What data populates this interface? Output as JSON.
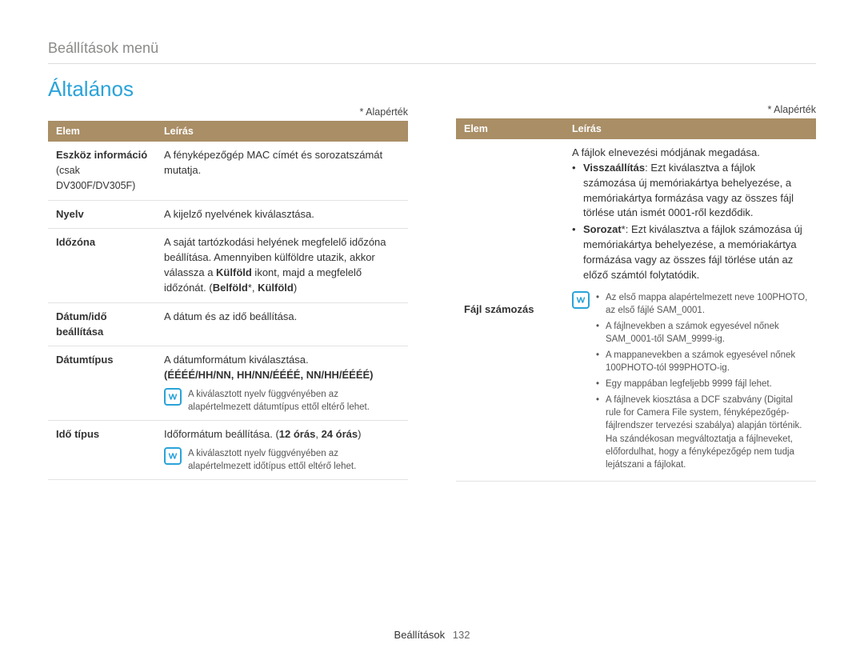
{
  "breadcrumb": "Beállítások menü",
  "section_title": "Általános",
  "default_note": "* Alapérték",
  "headers": {
    "item": "Elem",
    "desc": "Leírás"
  },
  "footer": {
    "section": "Beállítások",
    "page": "132"
  },
  "left": {
    "rows": {
      "r0": {
        "label_bold": "Eszköz információ",
        "label_sub": " (csak DV300F/DV305F)",
        "desc": "A fényképezőgép MAC címét és sorozatszámát mutatja."
      },
      "r1": {
        "label": "Nyelv",
        "desc": "A kijelző nyelvének kiválasztása."
      },
      "r2": {
        "label": "Időzóna",
        "desc_pre": "A saját tartózkodási helyének megfelelő időzóna beállítása. Amennyiben külföldre utazik, akkor válassza a ",
        "desc_bold1": "Külföld",
        "desc_mid": " ikont, majd a megfelelő időzónát. (",
        "desc_bold2": "Belföld",
        "desc_sep": "*, ",
        "desc_bold3": "Külföld",
        "desc_end": ")"
      },
      "r3": {
        "label": "Dátum/idő beállítása",
        "desc": "A dátum és az idő beállítása."
      },
      "r4": {
        "label": "Dátumtípus",
        "desc_line1": "A dátumformátum kiválasztása.",
        "desc_formats": "(ÉÉÉÉ/HH/NN, HH/NN/ÉÉÉÉ, NN/HH/ÉÉÉÉ)",
        "note": "A kiválasztott nyelv függvényében az alapértelmezett dátumtípus ettől eltérő lehet."
      },
      "r5": {
        "label": "Idő típus",
        "desc_pre": "Időformátum beállítása. (",
        "desc_b1": "12 órás",
        "desc_sep": ", ",
        "desc_b2": "24 órás",
        "desc_end": ")",
        "note": "A kiválasztott nyelv függvényében az alapértelmezett időtípus ettől eltérő lehet."
      }
    }
  },
  "right": {
    "row": {
      "label": "Fájl számozás",
      "intro": "A fájlok elnevezési módjának megadása.",
      "opt1_label": "Visszaállítás",
      "opt1_text": ": Ezt kiválasztva a fájlok számozása új memóriakártya behelyezése, a memóriakártya formázása vagy az összes fájl törlése után ismét 0001-ről kezdődik.",
      "opt2_label": "Sorozat",
      "opt2_text": "*: Ezt kiválasztva a fájlok számozása új memóriakártya behelyezése, a memóriakártya formázása vagy az összes fájl törlése után az előző számtól folytatódik.",
      "notes": {
        "n0": "Az első mappa alapértelmezett neve 100PHOTO, az első fájlé SAM_0001.",
        "n1": "A fájlnevekben a számok egyesével nőnek SAM_0001-től SAM_9999-ig.",
        "n2": "A mappanevekben a számok egyesével nőnek 100PHOTO-tól 999PHOTO-ig.",
        "n3": "Egy mappában legfeljebb 9999 fájl lehet.",
        "n4": "A fájlnevek kiosztása a DCF szabvány (Digital rule for Camera File system, fényképezőgép-fájlrendszer tervezési szabálya) alapján történik. Ha szándékosan megváltoztatja a fájlneveket, előfordulhat, hogy a fényképezőgép nem tudja lejátszani a fájlokat."
      }
    }
  }
}
